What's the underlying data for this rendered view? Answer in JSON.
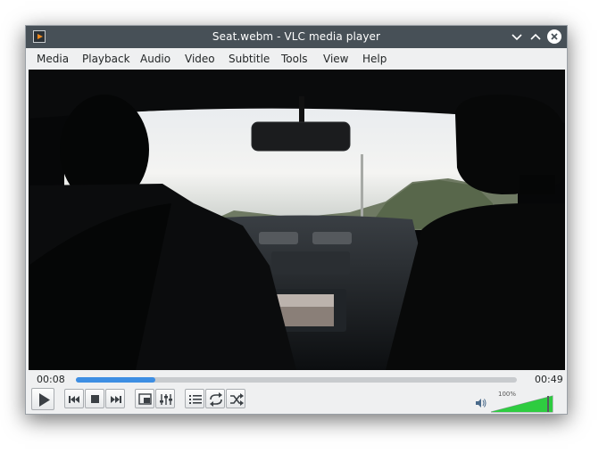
{
  "window": {
    "title": "Seat.webm - VLC media player"
  },
  "menu": [
    "Media",
    "Playback",
    "Audio",
    "Video",
    "Subtitle",
    "Tools",
    "View",
    "Help"
  ],
  "player": {
    "elapsed": "00:08",
    "total": "00:49",
    "progress_fraction": 0.18,
    "volume_label": "100%",
    "volume_fraction": 1.0
  },
  "controls": {
    "play": "play-icon",
    "previous": "previous-icon",
    "stop": "stop-icon",
    "next": "next-icon",
    "fullscreen": "fullscreen-icon",
    "extended_settings": "equalizer-icon",
    "playlist": "playlist-icon",
    "loop": "loop-icon",
    "random": "shuffle-icon"
  },
  "colors": {
    "accent": "#3d8ee3",
    "volume_green": "#2ecc40",
    "titlebar": "#475057"
  }
}
